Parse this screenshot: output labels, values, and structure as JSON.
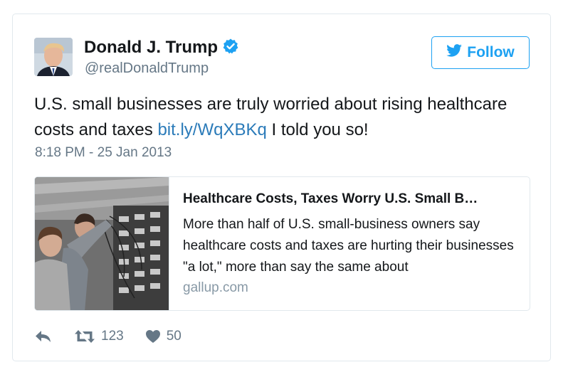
{
  "author": {
    "name": "Donald J. Trump",
    "handle": "@realDonaldTrump",
    "verified": true
  },
  "follow_button": {
    "label": "Follow",
    "icon": "twitter-bird-icon"
  },
  "tweet": {
    "text_before_link": "U.S. small businesses are truly worried about rising healthcare costs and taxes",
    "link_text": "bit.ly/WqXBKq",
    "text_after_link": "I told you so!",
    "timestamp": "8:18 PM - 25 Jan 2013"
  },
  "link_card": {
    "title": "Healthcare Costs, Taxes Worry U.S. Small B…",
    "description": "More than half of U.S. small-business owners say healthcare costs and taxes are hurting their businesses \"a lot,\" more than say the same about",
    "domain": "gallup.com"
  },
  "actions": {
    "reply": {
      "icon": "reply-icon"
    },
    "retweet": {
      "icon": "retweet-icon",
      "count": "123"
    },
    "like": {
      "icon": "heart-icon",
      "count": "50"
    }
  },
  "colors": {
    "accent": "#1da1f2",
    "link": "#2b7bb9",
    "text": "#14171a",
    "secondary_text": "#657786",
    "border": "#e1e8ed"
  }
}
